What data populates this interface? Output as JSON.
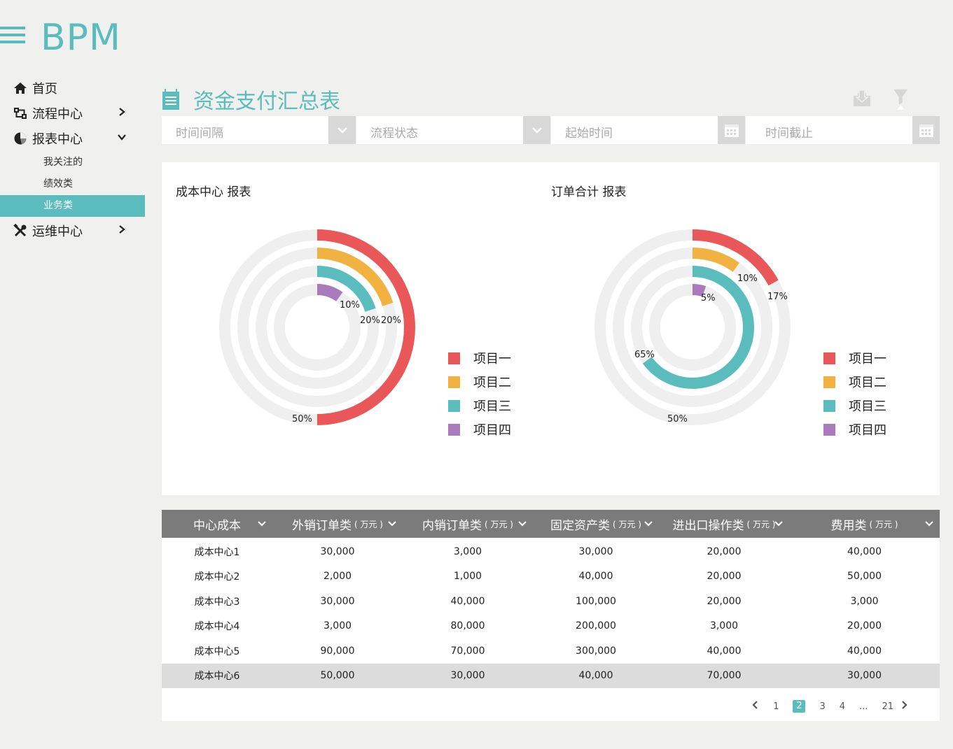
{
  "app": {
    "logo": "BPM"
  },
  "sidebar": {
    "items": [
      {
        "label": "首页",
        "icon": "home-icon"
      },
      {
        "label": "流程中心",
        "icon": "flow-icon"
      },
      {
        "label": "报表中心",
        "icon": "pie-icon"
      },
      {
        "label": "运维中心",
        "icon": "tools-icon"
      }
    ],
    "subitems": [
      "我关注的",
      "绩效类",
      "业务类"
    ],
    "active_subitem": "业务类"
  },
  "page": {
    "title": "资金支付汇总表"
  },
  "filters": {
    "interval_placeholder": "时间间隔",
    "status_placeholder": "流程状态",
    "start_placeholder": "起始时间",
    "end_placeholder": "时间截止"
  },
  "colors": {
    "accent": "#5bbcbd",
    "series": [
      "#e95758",
      "#f2b241",
      "#5bbcbd",
      "#a97bbd"
    ],
    "track": "#f0eff0"
  },
  "legend": [
    "项目一",
    "项目二",
    "项目三",
    "项目四"
  ],
  "chart_data": [
    {
      "type": "radial-bar",
      "title": "成本中心  报表",
      "series": [
        {
          "name": "项目一",
          "value": 50
        },
        {
          "name": "项目二",
          "value": 20
        },
        {
          "name": "项目三",
          "value": 20
        },
        {
          "name": "项目四",
          "value": 10
        }
      ],
      "labels": [
        "50%",
        "20%",
        "20%",
        "10%"
      ]
    },
    {
      "type": "radial-bar",
      "title": "订单合计  报表",
      "series": [
        {
          "name": "项目一",
          "value": 17
        },
        {
          "name": "项目二",
          "value": 10
        },
        {
          "name": "项目三",
          "value": 65
        },
        {
          "name": "项目四",
          "value": 5
        }
      ],
      "labels": [
        "17%",
        "10%",
        "65%",
        "5%",
        "50%"
      ]
    }
  ],
  "table": {
    "columns": [
      {
        "label": "中心成本",
        "unit": ""
      },
      {
        "label": "外销订单类",
        "unit": "( 万元 )"
      },
      {
        "label": "内销订单类",
        "unit": "( 万元 )"
      },
      {
        "label": "固定资产类",
        "unit": "( 万元 )"
      },
      {
        "label": "进出口操作类",
        "unit": "( 万元 )"
      },
      {
        "label": "费用类",
        "unit": "( 万元 )"
      }
    ],
    "rows": [
      [
        "成本中心1",
        "30,000",
        "3,000",
        "30,000",
        "20,000",
        "40,000"
      ],
      [
        "成本中心2",
        "2,000",
        "1,000",
        "40,000",
        "20,000",
        "50,000"
      ],
      [
        "成本中心3",
        "30,000",
        "40,000",
        "100,000",
        "20,000",
        "3,000"
      ],
      [
        "成本中心4",
        "3,000",
        "80,000",
        "200,000",
        "3,000",
        "20,000"
      ],
      [
        "成本中心5",
        "90,000",
        "70,000",
        "300,000",
        "40,000",
        "40,000"
      ],
      [
        "成本中心6",
        "50,000",
        "30,000",
        "40,000",
        "70,000",
        "30,000"
      ]
    ],
    "highlighted_row": 5
  },
  "pagination": {
    "pages": [
      "1",
      "2",
      "3",
      "4",
      "...",
      "21"
    ],
    "current": "2"
  }
}
